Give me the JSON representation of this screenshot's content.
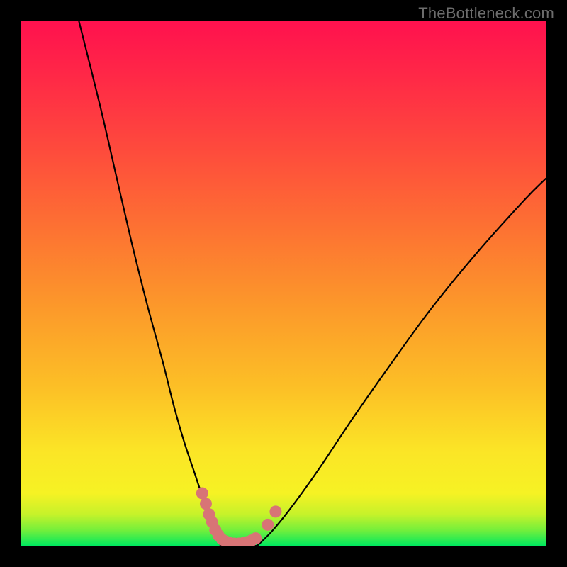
{
  "watermark": "TheBottleneck.com",
  "chart_data": {
    "type": "line",
    "title": "",
    "xlabel": "",
    "ylabel": "",
    "xlim": [
      0,
      100
    ],
    "ylim": [
      0,
      100
    ],
    "gradient_bands": [
      {
        "y": 0,
        "color": "#00e95f"
      },
      {
        "y": 3,
        "color": "#75ef3b"
      },
      {
        "y": 6,
        "color": "#c6f22a"
      },
      {
        "y": 10,
        "color": "#f6f224"
      },
      {
        "y": 18,
        "color": "#fbe526"
      },
      {
        "y": 30,
        "color": "#fcc026"
      },
      {
        "y": 45,
        "color": "#fc9a2a"
      },
      {
        "y": 60,
        "color": "#fd7332"
      },
      {
        "y": 75,
        "color": "#fe4c3c"
      },
      {
        "y": 90,
        "color": "#ff2747"
      },
      {
        "y": 100,
        "color": "#ff114e"
      }
    ],
    "series": [
      {
        "name": "left-branch",
        "x": [
          11,
          15,
          18,
          21,
          24,
          27,
          29,
          31,
          33,
          35,
          36.5,
          38
        ],
        "y": [
          100,
          84,
          71,
          58,
          46,
          35,
          27,
          20,
          14,
          8,
          4,
          0
        ]
      },
      {
        "name": "right-branch",
        "x": [
          45,
          48,
          52,
          57,
          63,
          70,
          78,
          87,
          96,
          100
        ],
        "y": [
          0,
          3,
          8,
          15,
          24,
          34,
          45,
          56,
          66,
          70
        ]
      },
      {
        "name": "valley-floor",
        "x": [
          38,
          40,
          42,
          44,
          45
        ],
        "y": [
          0,
          0,
          0,
          0,
          0
        ]
      }
    ],
    "scatter_clusters": [
      {
        "name": "left-cluster",
        "color": "#d87476",
        "points": [
          {
            "x": 34.5,
            "y": 10
          },
          {
            "x": 35.2,
            "y": 8
          },
          {
            "x": 35.8,
            "y": 6
          },
          {
            "x": 36.4,
            "y": 4.5
          },
          {
            "x": 37.0,
            "y": 3
          },
          {
            "x": 37.6,
            "y": 2
          },
          {
            "x": 38.3,
            "y": 1.2
          },
          {
            "x": 39.0,
            "y": 0.8
          },
          {
            "x": 39.8,
            "y": 0.5
          },
          {
            "x": 40.6,
            "y": 0.4
          },
          {
            "x": 41.5,
            "y": 0.4
          },
          {
            "x": 42.3,
            "y": 0.5
          },
          {
            "x": 43.1,
            "y": 0.7
          },
          {
            "x": 43.9,
            "y": 1.0
          },
          {
            "x": 44.7,
            "y": 1.4
          }
        ]
      },
      {
        "name": "right-cluster",
        "color": "#d87476",
        "points": [
          {
            "x": 47.0,
            "y": 4.0
          },
          {
            "x": 48.5,
            "y": 6.5
          }
        ]
      }
    ]
  }
}
